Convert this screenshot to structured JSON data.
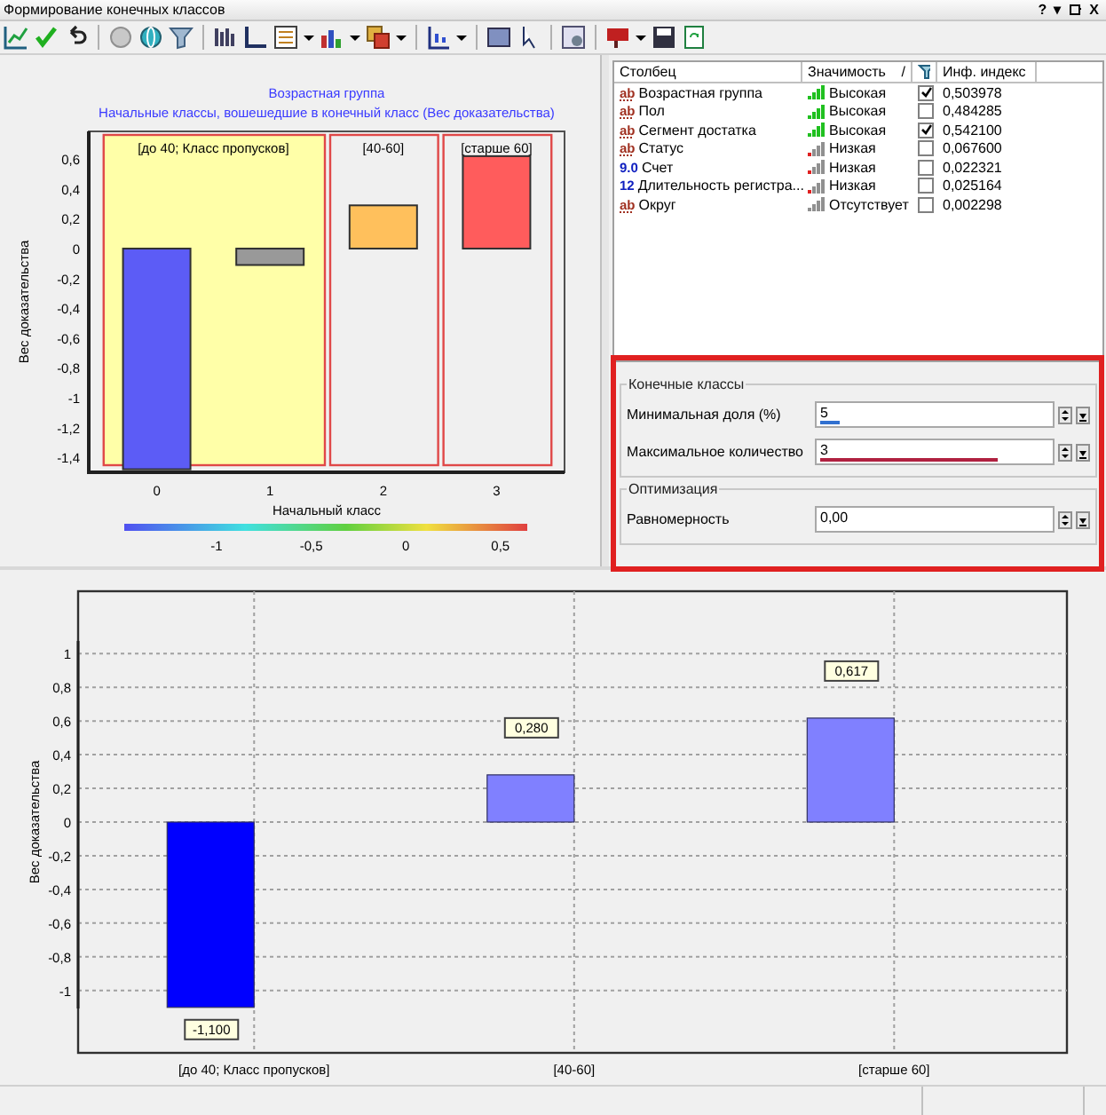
{
  "window": {
    "title": "Формирование конечных классов",
    "controls": [
      "?",
      "▾",
      "X"
    ]
  },
  "chart_top": {
    "title_lines": [
      "Возрастная группа",
      "Начальные классы, вошешедшие в конечный класс (Вес доказательства)"
    ],
    "chart_data": {
      "type": "bar",
      "xlabel": "Начальный класс",
      "ylabel": "Вес доказательства",
      "categories": [
        "0",
        "1",
        "2",
        "3"
      ],
      "series": [
        {
          "colors": [
            "#5c5cf6",
            "#999999",
            "#ffc05c",
            "#ff5c5c"
          ],
          "values": [
            -1.48,
            -0.11,
            0.29,
            0.62
          ]
        }
      ],
      "ylim": [
        -1.5,
        0.786
      ],
      "yticks": [
        {
          "value": 0.6,
          "label": "0,6"
        },
        {
          "value": 0.4,
          "label": "0,4"
        },
        {
          "value": 0.2,
          "label": "0,2"
        },
        {
          "value": 0,
          "label": "0"
        },
        {
          "value": -0.2,
          "label": "-0,2"
        },
        {
          "value": -0.4,
          "label": "-0,4"
        },
        {
          "value": -0.6,
          "label": "-0,6"
        },
        {
          "value": -0.8,
          "label": "-0,8"
        },
        {
          "value": -1,
          "label": "-1"
        },
        {
          "value": -1.2,
          "label": "-1,2"
        },
        {
          "value": -1.4,
          "label": "-1,4"
        }
      ]
    },
    "class_bands": [
      {
        "label": "[до 40; Класс пропусков]",
        "highlighted": true
      },
      {
        "label": "[40-60]",
        "highlighted": false
      },
      {
        "label": "[старше 60]",
        "highlighted": false
      }
    ],
    "color_scale": {
      "ticks": [
        "-1",
        "-0,5",
        "0",
        "0,5"
      ]
    }
  },
  "table": {
    "columns": [
      "Столбец",
      "Значимость",
      "Инф. индекс"
    ],
    "sort_mark": "/",
    "rows": [
      {
        "type": "ab",
        "name": "Возрастная группа",
        "kind": "high",
        "significance": "Высокая",
        "checked": true,
        "index": "0,503978"
      },
      {
        "type": "ab",
        "name": "Пол",
        "kind": "high",
        "significance": "Высокая",
        "checked": false,
        "index": "0,484285"
      },
      {
        "type": "ab",
        "name": "Сегмент достатка",
        "kind": "high",
        "significance": "Высокая",
        "checked": true,
        "index": "0,542100"
      },
      {
        "type": "ab",
        "name": "Статус",
        "kind": "low",
        "significance": "Низкая",
        "checked": false,
        "index": "0,067600"
      },
      {
        "type": "9.0",
        "name": "Счет",
        "kind": "low",
        "significance": "Низкая",
        "checked": false,
        "index": "0,022321"
      },
      {
        "type": "12",
        "name": "Длительность регистра...",
        "kind": "low",
        "significance": "Низкая",
        "checked": false,
        "index": "0,025164"
      },
      {
        "type": "ab",
        "name": "Округ",
        "kind": "none",
        "significance": "Отсутствует",
        "checked": false,
        "index": "0,002298"
      }
    ]
  },
  "groups": [
    {
      "title": "Конечные классы",
      "fields": [
        {
          "label": "Минимальная доля (%)",
          "value": "5",
          "level": 0.08,
          "color": "#3070d0"
        },
        {
          "label": "Максимальное количество",
          "value": "3",
          "level": 0.75,
          "color": "#b02040"
        }
      ]
    },
    {
      "title": "Оптимизация",
      "fields": [
        {
          "label": "Равномерность",
          "value": "0,00"
        }
      ]
    }
  ],
  "chart_bottom": {
    "chart_data": {
      "type": "bar",
      "ylabel": "Вес доказательства",
      "categories": [
        "[до 40; Класс пропусков]",
        "[40-60]",
        "[старше 60]"
      ],
      "series": [
        {
          "colors": [
            "#0000ff",
            "#8080ff",
            "#8080ff"
          ],
          "values": [
            -1.1,
            0.28,
            0.617
          ]
        }
      ],
      "ylim": [
        -1.37,
        1.37
      ],
      "grid": true,
      "yticks": [
        {
          "value": 1,
          "label": "1"
        },
        {
          "value": 0.8,
          "label": "0,8"
        },
        {
          "value": 0.6,
          "label": "0,6"
        },
        {
          "value": 0.4,
          "label": "0,4"
        },
        {
          "value": 0.2,
          "label": "0,2"
        },
        {
          "value": 0,
          "label": "0"
        },
        {
          "value": -0.2,
          "label": "-0,2"
        },
        {
          "value": -0.4,
          "label": "-0,4"
        },
        {
          "value": -0.6,
          "label": "-0,6"
        },
        {
          "value": -0.8,
          "label": "-0,8"
        },
        {
          "value": -1,
          "label": "-1"
        }
      ],
      "value_labels": [
        "-1,100",
        "0,280",
        "0,617"
      ]
    }
  }
}
